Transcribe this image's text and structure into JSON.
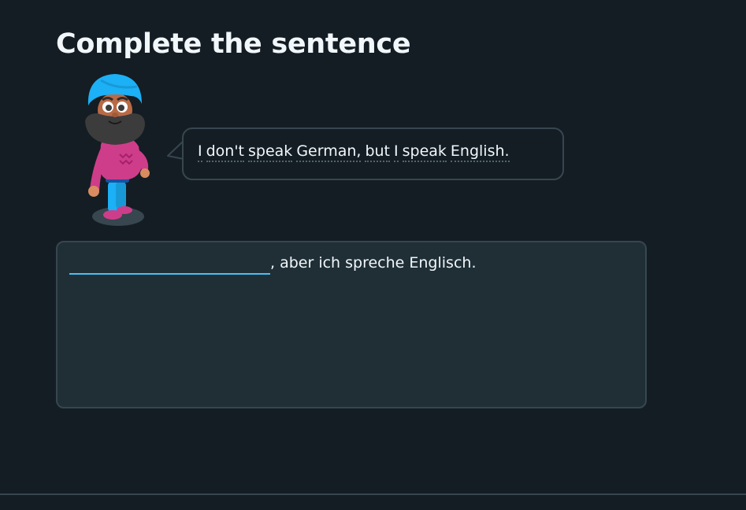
{
  "exercise": {
    "title": "Complete the sentence",
    "prompt_words": [
      "I",
      "don't",
      "speak",
      "German,",
      "but",
      "I",
      "speak",
      "English."
    ],
    "answer": {
      "input_value": "",
      "sentence_rest": ", aber ich spreche Englisch."
    }
  },
  "character": {
    "icon": "turban-character-illustration"
  },
  "colors": {
    "background": "#141d23",
    "panel": "#202f36",
    "border": "#37464f",
    "input_underline": "#49c0f8",
    "text": "#f1f7fb"
  }
}
